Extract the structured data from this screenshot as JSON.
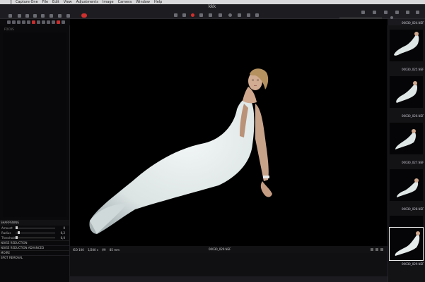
{
  "menubar": {
    "apple_glyph": "",
    "items": [
      "Capture One",
      "File",
      "Edit",
      "View",
      "Adjustments",
      "Image",
      "Camera",
      "Window",
      "Help"
    ]
  },
  "document": {
    "title": "kkk"
  },
  "left_panel": {
    "header": "FOCUS",
    "sharpening": {
      "title": "SHARPENING",
      "amount_label": "Amount",
      "amount_value": "0",
      "radius_label": "Radius",
      "radius_value": "0,2",
      "threshold_label": "Threshold",
      "threshold_value": "0,0"
    },
    "sections": [
      "NOISE REDUCTION",
      "NOISE REDUCTION ADVANCED",
      "MOIRE",
      "SPOT REMOVAL"
    ]
  },
  "statusbar": {
    "iso": "ISO 100",
    "shutter": "1/200 s",
    "aperture": "f/9",
    "focal": "85 mm",
    "filename": "00030_029.NEF"
  },
  "browser": {
    "thumbnails": [
      {
        "label": "00030_024.NEF"
      },
      {
        "label": "00030_025.NEF"
      },
      {
        "label": "00030_026.NEF"
      },
      {
        "label": "00030_027.NEF"
      },
      {
        "label": "00030_028.NEF"
      },
      {
        "label": "00030_029.NEF",
        "selected": true
      }
    ]
  },
  "colors": {
    "accent_red": "#d0302e",
    "dress": "#e6ecec",
    "skin": "#caa48a"
  }
}
